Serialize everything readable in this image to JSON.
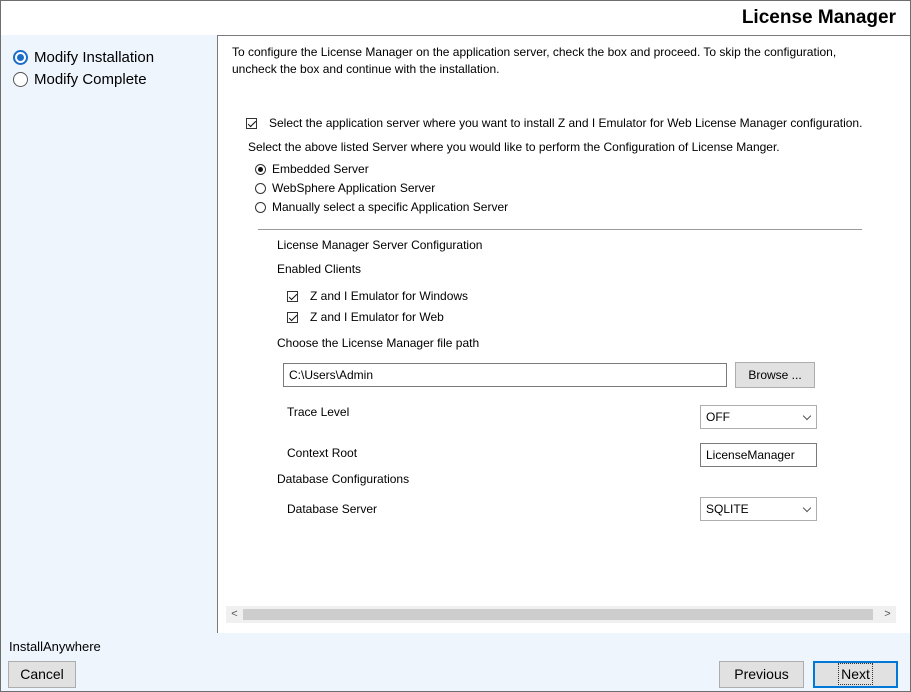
{
  "header": {
    "title": "License Manager"
  },
  "sidebar": {
    "steps": [
      {
        "label": "Modify Installation",
        "active": true
      },
      {
        "label": "Modify Complete",
        "active": false
      }
    ]
  },
  "main": {
    "intro": "To configure the License Manager on the application server, check the box and proceed. To skip the configuration, uncheck the box and continue with the installation.",
    "select_server_checkbox": {
      "label": "Select the application server where you want to install Z and I Emulator for Web License Manager configuration.",
      "checked": true
    },
    "server_prompt": "Select the above listed Server where you would like to perform the Configuration of License Manger.",
    "servers": [
      {
        "label": "Embedded Server",
        "selected": true
      },
      {
        "label": "WebSphere Application Server",
        "selected": false
      },
      {
        "label": "Manually select a specific Application Server",
        "selected": false
      }
    ],
    "config_title": "License Manager Server Configuration",
    "enabled_clients_label": "Enabled Clients",
    "clients": [
      {
        "label": "Z and I Emulator for Windows",
        "checked": true
      },
      {
        "label": "Z and I Emulator for Web",
        "checked": true
      }
    ],
    "file_path_label": "Choose the License Manager file path",
    "file_path_value": "C:\\Users\\Admin",
    "browse_label": "Browse ...",
    "trace_level_label": "Trace Level",
    "trace_level_value": "OFF",
    "context_root_label": "Context Root",
    "context_root_value": "LicenseManager",
    "db_config_label": "Database Configurations",
    "db_server_label": "Database Server",
    "db_server_value": "SQLITE",
    "scroll_left": "<",
    "scroll_right": ">"
  },
  "footer": {
    "brand": "InstallAnywhere",
    "cancel_label": "Cancel",
    "previous_label": "Previous",
    "next_label": "Next"
  },
  "colors": {
    "accent": "#0078d7",
    "sidebar_bg": "#eef5fd"
  },
  "icons": [
    "radio-selected-icon",
    "radio-unselected-icon",
    "checkbox-checked-icon",
    "chevron-down-icon",
    "scroll-left-icon",
    "scroll-right-icon"
  ]
}
